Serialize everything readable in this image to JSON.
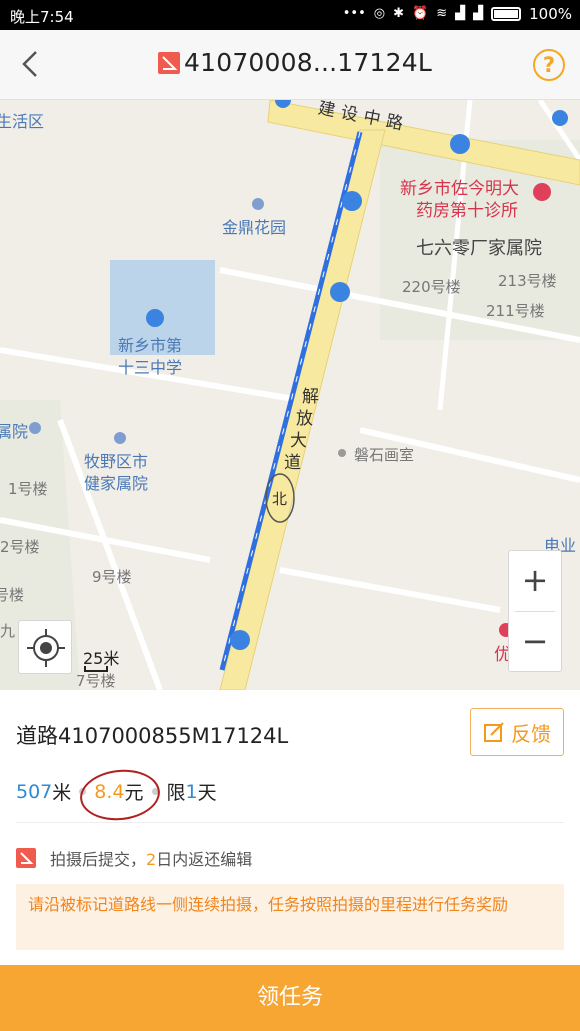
{
  "status_bar": {
    "time": "晚上7:54",
    "battery": "100%"
  },
  "header": {
    "title": "41070008...17124L",
    "help_label": "?"
  },
  "map": {
    "labels": {
      "jianshe_road": "建设中路",
      "jinding": "金鼎花园",
      "school_line1": "新乡市第",
      "school_line2": "十三中学",
      "clinic_line1": "新乡市佐今明大",
      "clinic_line2": "药房第十诊所",
      "factory": "七六零厂家属院",
      "b220": "220号楼",
      "b213": "213号楼",
      "b211": "211号楼",
      "muye_line1": "牧野区市",
      "muye_line2": "健家属院",
      "panshi": "磐石画室",
      "b1": "1号楼",
      "b2": "2号楼",
      "b9": "9号楼",
      "b7": "7号楼",
      "shenghuoqu": "生活区",
      "yuan": "属院",
      "dianye": "电业",
      "jiu": "九",
      "hao": "号楼",
      "you": "优"
    },
    "road_chars": [
      "解",
      "放",
      "大",
      "道"
    ],
    "road_north": "北",
    "scale": "25米",
    "zoom_in": "+",
    "zoom_out": "−"
  },
  "panel": {
    "road_name": "道路4107000855M17124L",
    "feedback_label": "反馈",
    "distance_value": "507",
    "distance_unit": "米",
    "price_value": "8.4",
    "price_unit": "元",
    "limit_prefix": "限",
    "limit_value": "1",
    "limit_unit": "天",
    "note_prefix": "拍摄后提交，",
    "note_days": "2",
    "note_suffix": "日内返还编辑",
    "tip": "请沿被标记道路线一侧连续拍摄，任务按照拍摄的里程进行任务奖励"
  },
  "cta_label": "领任务"
}
